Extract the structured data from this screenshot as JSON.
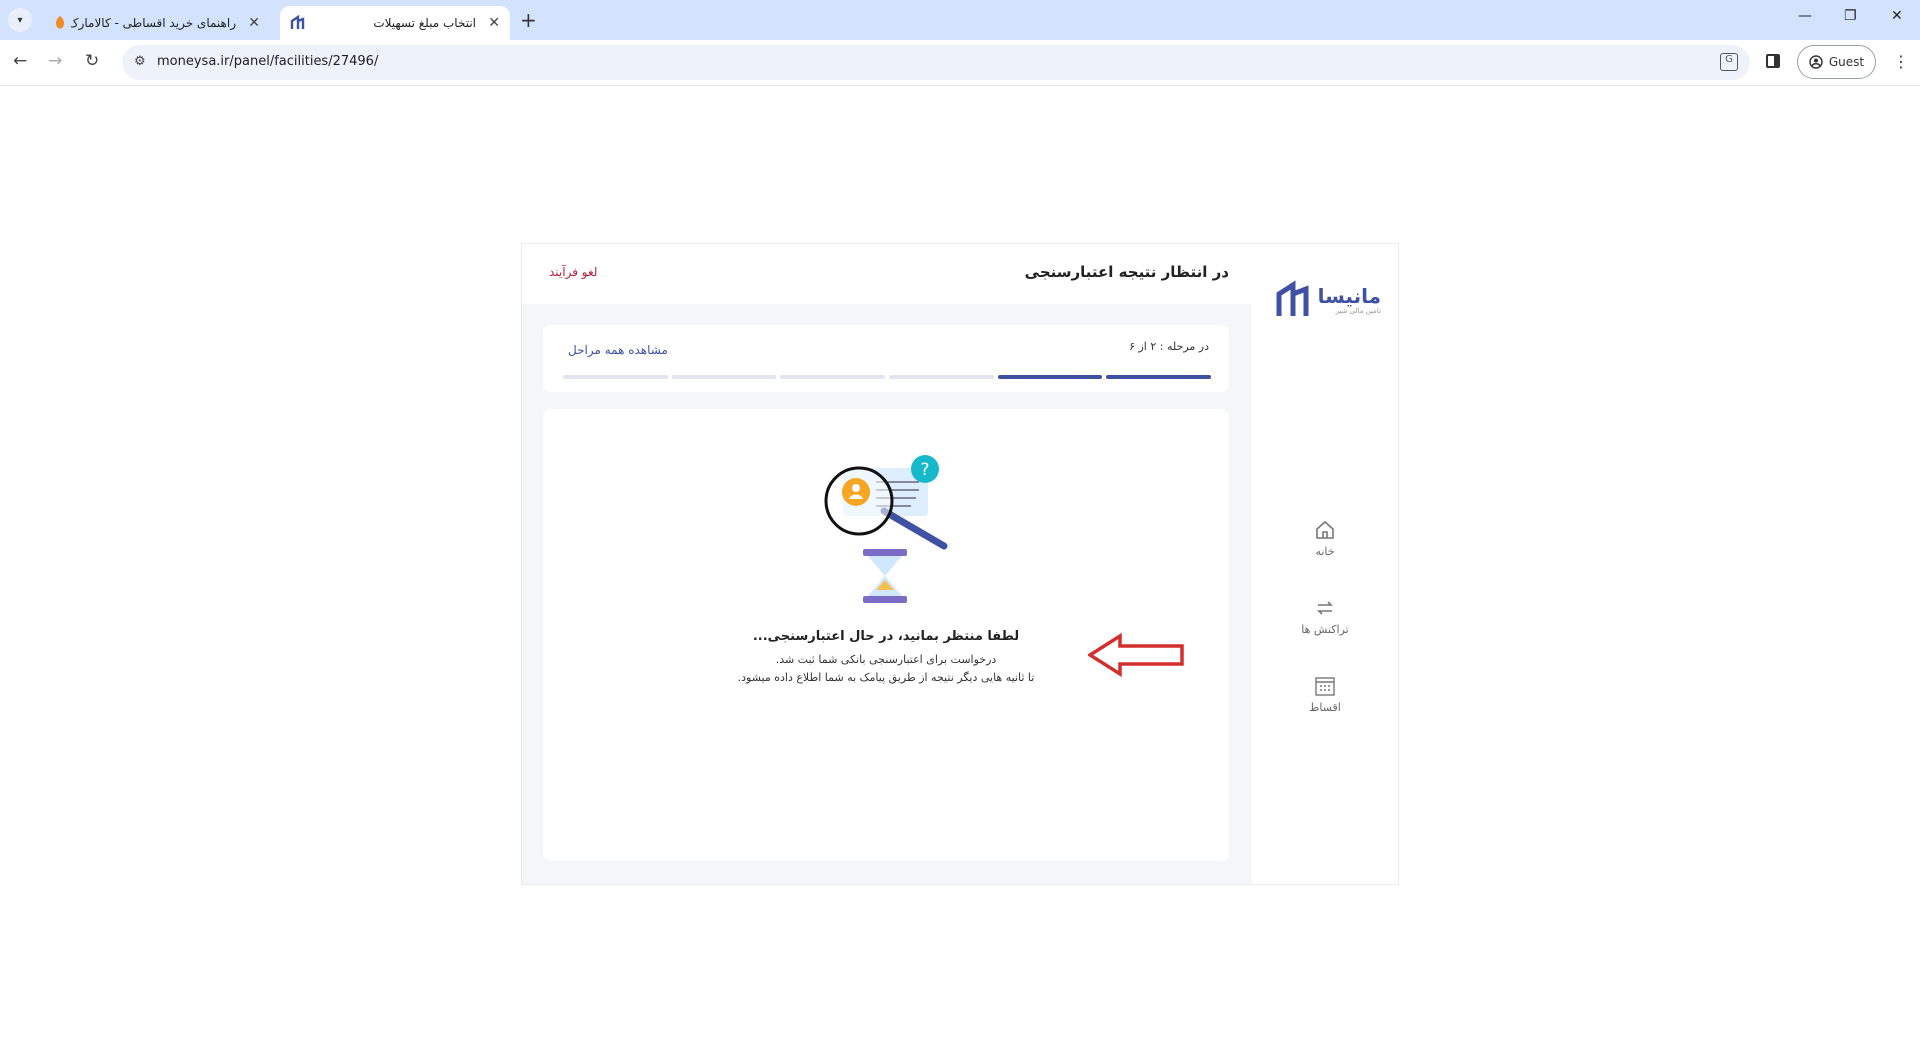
{
  "browser": {
    "tabs": [
      {
        "title": "راهنمای خرید اقساطی - کالامارک",
        "active": false
      },
      {
        "title": "انتخاب مبلغ تسهیلات",
        "active": true
      }
    ],
    "url": "moneysa.ir/panel/facilities/27496/",
    "profile_label": "Guest"
  },
  "brand": {
    "name": "مانیسا",
    "tagline": "تامین مالی شیر",
    "accent_color": "#3f51a3"
  },
  "sidebar": {
    "items": [
      {
        "label": "خانه",
        "icon": "home-icon"
      },
      {
        "label": "تراکنش ها",
        "icon": "transactions-icon"
      },
      {
        "label": "اقساط",
        "icon": "calendar-icon"
      }
    ]
  },
  "header": {
    "title": "در انتظار نتیجه اعتبارسنجی",
    "cancel_label": "لغو فرآیند"
  },
  "steps": {
    "label": "در مرحله : ۲ از ۶",
    "view_all_label": "مشاهده همه مراحل",
    "current": 2,
    "total": 6
  },
  "status": {
    "title": "لطفا منتظر بمانید، در حال اعتبارسنجی...",
    "line1": "درخواست برای اعتبارسنجی بانکی شما ثبت شد.",
    "line2": "تا ثانیه هایی دیگر نتیجه از طریق پیامک به شما اطلاع داده میشود."
  },
  "annotation": {
    "arrow_color": "#d32f2f"
  }
}
